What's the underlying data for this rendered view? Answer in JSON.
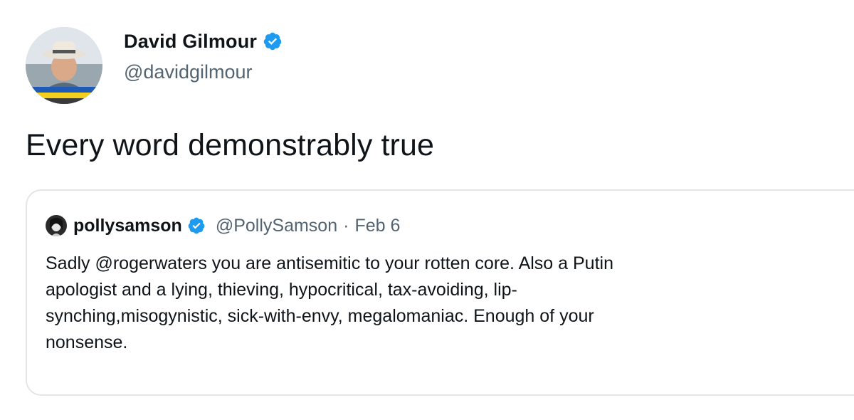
{
  "tweet": {
    "author": {
      "name": "David Gilmour",
      "handle": "@davidgilmour",
      "verified": true
    },
    "text": "Every word demonstrably true"
  },
  "quoted_tweet": {
    "author": {
      "name": "pollysamson",
      "handle": "@PollySamson",
      "verified": true
    },
    "separator": "·",
    "date": "Feb 6",
    "body": "Sadly @rogerwaters you are antisemitic to your rotten core. Also a Putin\napologist and a lying, thieving, hypocritical, tax-avoiding, lip-\nsynching,misogynistic, sick-with-envy, megalomaniac. Enough of your\nnonsense."
  },
  "colors": {
    "verified_blue": "#1d9bf0",
    "text_primary": "#0f1419",
    "text_secondary": "#536471",
    "border": "#e3e6e8"
  },
  "icons": {
    "verified": "verified-badge-icon"
  }
}
